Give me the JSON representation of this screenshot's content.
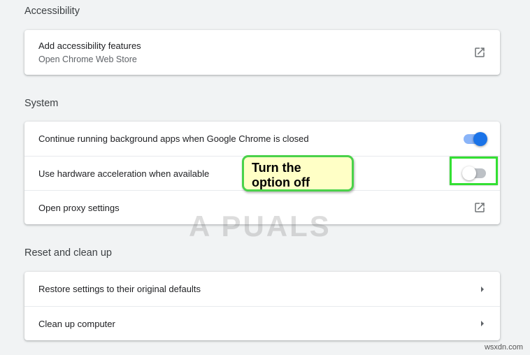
{
  "sections": {
    "accessibility": {
      "title": "Accessibility",
      "item": {
        "label": "Add accessibility features",
        "sublabel": "Open Chrome Web Store",
        "icon": "open-external-icon"
      }
    },
    "system": {
      "title": "System",
      "items": [
        {
          "label": "Continue running background apps when Google Chrome is closed",
          "control": "toggle",
          "state": "on"
        },
        {
          "label": "Use hardware acceleration when available",
          "control": "toggle",
          "state": "off"
        },
        {
          "label": "Open proxy settings",
          "control": "open-external-icon"
        }
      ]
    },
    "reset": {
      "title": "Reset and clean up",
      "items": [
        {
          "label": "Restore settings to their original defaults",
          "control": "chevron-right-icon"
        },
        {
          "label": "Clean up computer",
          "control": "chevron-right-icon"
        }
      ]
    }
  },
  "annotation": {
    "callout_line1": "Turn the",
    "callout_line2": "option off"
  },
  "watermark": "A  PUALS",
  "corner_mark": "wsxdn.com",
  "colors": {
    "page_bg": "#f1f3f4",
    "toggle_on": "#1a73e8",
    "toggle_on_track": "#8ab4f8",
    "toggle_off_track": "#bdc1c6",
    "highlight": "#33e033",
    "callout_bg": "#ffffc6"
  }
}
